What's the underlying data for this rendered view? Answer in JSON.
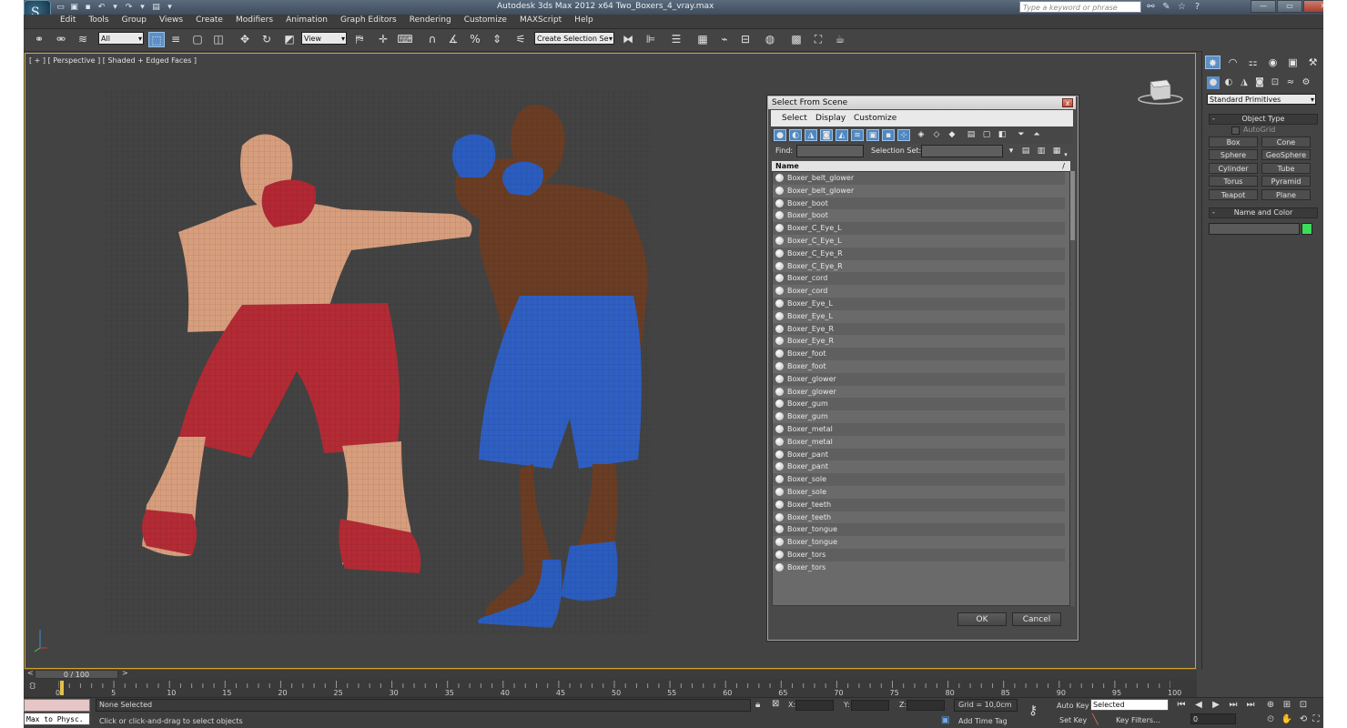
{
  "app": {
    "title": "Autodesk 3ds Max  2012 x64      Two_Boxers_4_vray.max",
    "logo": "3ds-max-logo",
    "search_placeholder": "Type a keyword or phrase"
  },
  "menu": [
    "Edit",
    "Tools",
    "Group",
    "Views",
    "Create",
    "Modifiers",
    "Animation",
    "Graph Editors",
    "Rendering",
    "Customize",
    "MAXScript",
    "Help"
  ],
  "toolbar": {
    "selection_filter": "All",
    "reference_coord": "View",
    "named_selection_placeholder": "Create Selection Se"
  },
  "viewport": {
    "label": "[ + ] [ Perspective ] [ Shaded + Edged Faces ]",
    "viewcube_label": "LEFT"
  },
  "command_panel": {
    "category": "Standard Primitives",
    "object_type_title": "Object Type",
    "autogrid_label": "AutoGrid",
    "buttons": [
      "Box",
      "Cone",
      "Sphere",
      "GeoSphere",
      "Cylinder",
      "Tube",
      "Torus",
      "Pyramid",
      "Teapot",
      "Plane"
    ],
    "name_color_title": "Name and Color",
    "color": "#3ddb5a",
    "rollout_minus": "-"
  },
  "time": {
    "position": "0 / 100",
    "tick_labels": [
      "0",
      "5",
      "10",
      "15",
      "20",
      "25",
      "30",
      "35",
      "40",
      "45",
      "50",
      "55",
      "60",
      "65",
      "70",
      "75",
      "80",
      "85",
      "90",
      "95",
      "100"
    ]
  },
  "status": {
    "selection": "None Selected",
    "prompt": "Click or click-and-drag to select objects",
    "x_label": "X:",
    "y_label": "Y:",
    "z_label": "Z:",
    "grid": "Grid = 10,0cm",
    "add_time_tag": "Add Time Tag",
    "auto_key": "Auto Key",
    "set_key": "Set Key",
    "key_mode": "Selected",
    "key_filters": "Key Filters...",
    "frame": "0",
    "maxscript": "Max to Physc."
  },
  "dialog": {
    "title": "Select From Scene",
    "menu": [
      "Select",
      "Display",
      "Customize"
    ],
    "find_label": "Find:",
    "selection_set_label": "Selection Set:",
    "column_name": "Name",
    "column_sort_icon": "/",
    "items": [
      "Boxer_belt_glower",
      "Boxer_belt_glower",
      "Boxer_boot",
      "Boxer_boot",
      "Boxer_C_Eye_L",
      "Boxer_C_Eye_L",
      "Boxer_C_Eye_R",
      "Boxer_C_Eye_R",
      "Boxer_cord",
      "Boxer_cord",
      "Boxer_Eye_L",
      "Boxer_Eye_L",
      "Boxer_Eye_R",
      "Boxer_Eye_R",
      "Boxer_foot",
      "Boxer_foot",
      "Boxer_glower",
      "Boxer_glower",
      "Boxer_gum",
      "Boxer_gum",
      "Boxer_metal",
      "Boxer_metal",
      "Boxer_pant",
      "Boxer_pant",
      "Boxer_sole",
      "Boxer_sole",
      "Boxer_teeth",
      "Boxer_teeth",
      "Boxer_tongue",
      "Boxer_tongue",
      "Boxer_tors",
      "Boxer_tors"
    ],
    "ok_label": "OK",
    "cancel_label": "Cancel",
    "close_glyph": "x"
  },
  "colors": {
    "viewport_border": "#d6a12a",
    "active_button": "#5c8fc6",
    "red_shorts": "#b42b35",
    "blue_shorts": "#2c5ec0",
    "skin_light": "#d9a07f",
    "skin_dark": "#6e3f24"
  }
}
